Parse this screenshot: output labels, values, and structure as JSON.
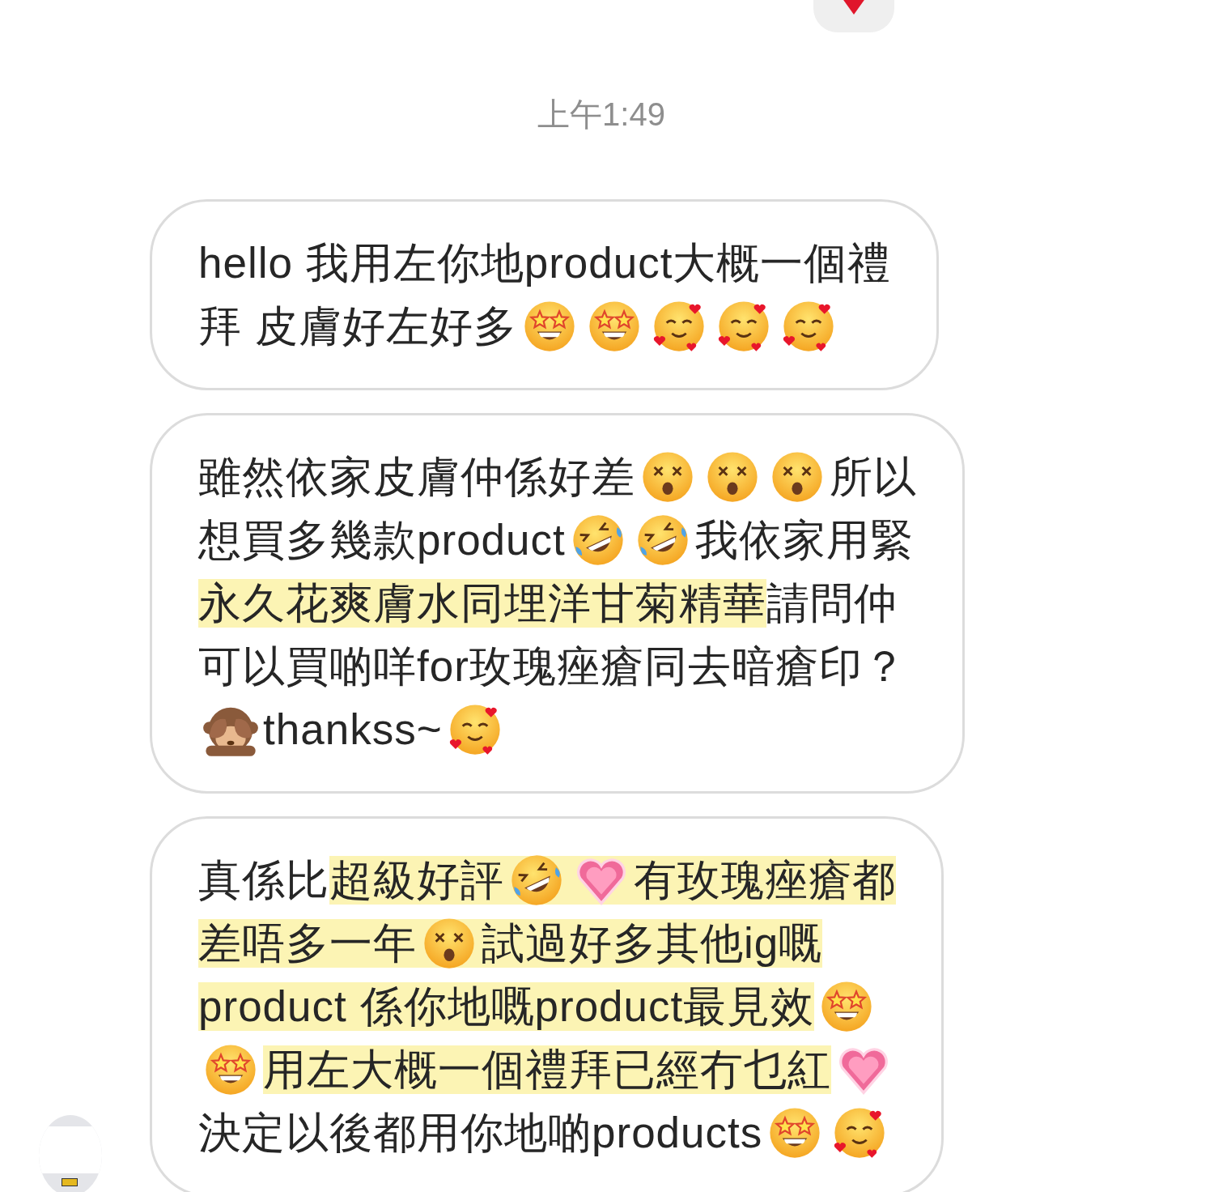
{
  "reaction": {
    "kind": "heart"
  },
  "timestamp": "上午1:49",
  "messages": [
    {
      "lines": [
        [
          {
            "kind": "text",
            "text": "hello 我用左你地product大概一個禮",
            "highlighted": false
          }
        ],
        [
          {
            "kind": "text",
            "text": "拜 皮膚好左好多",
            "highlighted": false
          },
          {
            "kind": "starstruck",
            "highlighted": false
          },
          {
            "kind": "starstruck",
            "highlighted": false
          },
          {
            "kind": "hearts",
            "highlighted": false
          },
          {
            "kind": "hearts",
            "highlighted": false
          },
          {
            "kind": "hearts",
            "highlighted": false
          }
        ]
      ]
    },
    {
      "lines": [
        [
          {
            "kind": "text",
            "text": "雖然依家皮膚仲係好差",
            "highlighted": false
          },
          {
            "kind": "dizzy",
            "highlighted": false
          },
          {
            "kind": "dizzy",
            "highlighted": false
          },
          {
            "kind": "dizzy",
            "highlighted": false
          },
          {
            "kind": "text",
            "text": "所以",
            "highlighted": false
          }
        ],
        [
          {
            "kind": "text",
            "text": "想買多幾款product",
            "highlighted": false
          },
          {
            "kind": "rofl",
            "highlighted": false
          },
          {
            "kind": "rofl",
            "highlighted": false
          },
          {
            "kind": "text",
            "text": " 我依家用緊",
            "highlighted": false
          }
        ],
        [
          {
            "kind": "text",
            "text": "永久花爽膚水同埋洋甘菊精華",
            "highlighted": true
          },
          {
            "kind": "text",
            "text": " 請問仲",
            "highlighted": false
          }
        ],
        [
          {
            "kind": "text",
            "text": "可以買啲咩for玫瑰痤瘡同去暗瘡印？",
            "highlighted": false
          }
        ],
        [
          {
            "kind": "monkey",
            "highlighted": false
          },
          {
            "kind": "text",
            "text": "thankss~",
            "highlighted": false
          },
          {
            "kind": "hearts",
            "highlighted": false
          }
        ]
      ]
    },
    {
      "lines": [
        [
          {
            "kind": "text",
            "text": "真係比",
            "highlighted": false
          },
          {
            "kind": "text",
            "text": "超級好評",
            "highlighted": true
          },
          {
            "kind": "rofl",
            "highlighted": true
          },
          {
            "kind": "heart",
            "highlighted": true
          },
          {
            "kind": "text",
            "text": "有玫瑰痤瘡都",
            "highlighted": true
          }
        ],
        [
          {
            "kind": "text",
            "text": "差唔多一年",
            "highlighted": true
          },
          {
            "kind": "dizzy",
            "highlighted": true
          },
          {
            "kind": "text",
            "text": "試過好多其他ig嘅",
            "highlighted": true
          }
        ],
        [
          {
            "kind": "text",
            "text": "product 係你地嘅product最見效",
            "highlighted": true
          },
          {
            "kind": "starstruck",
            "highlighted": false
          }
        ],
        [
          {
            "kind": "starstruck",
            "highlighted": false
          },
          {
            "kind": "text",
            "text": "用左大概一個禮拜已經冇乜紅",
            "highlighted": true
          },
          {
            "kind": "heart",
            "highlighted": false
          }
        ],
        [
          {
            "kind": "text",
            "text": "決定以後都用你地啲products",
            "highlighted": false
          },
          {
            "kind": "starstruck",
            "highlighted": false
          },
          {
            "kind": "hearts",
            "highlighted": false
          }
        ]
      ]
    }
  ]
}
